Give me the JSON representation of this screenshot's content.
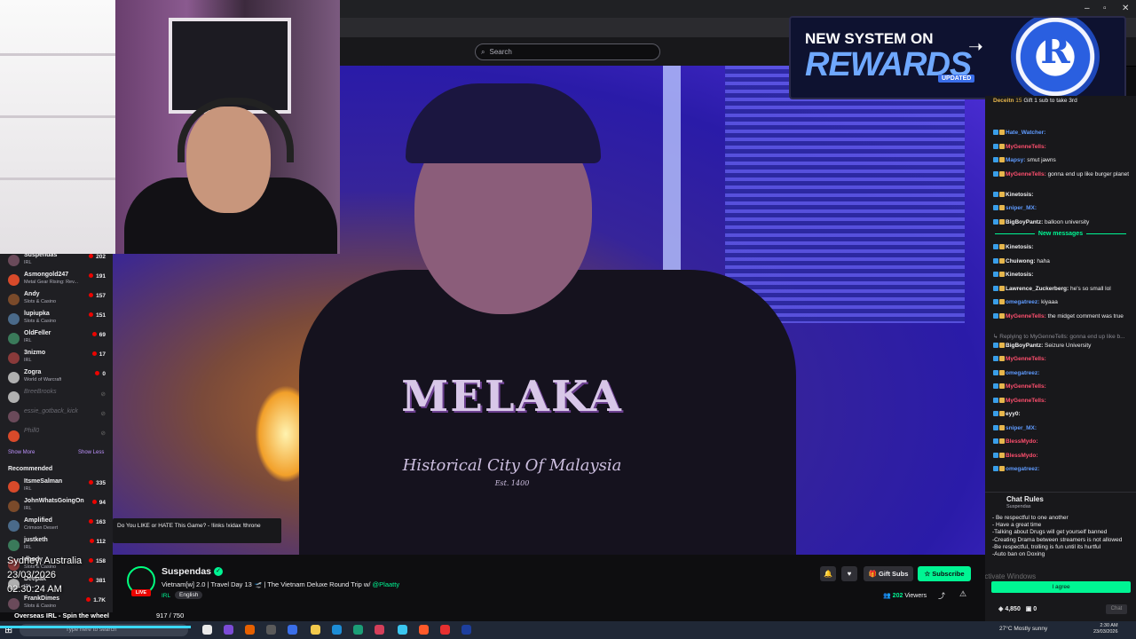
{
  "browser": {
    "search_placeholder": "Search"
  },
  "sidebar": {
    "followed": [
      {
        "name": "Suspendas",
        "game": "IRL",
        "viewers": "202"
      },
      {
        "name": "Asmongold247",
        "game": "Metal Gear Rising: Rev...",
        "viewers": "191"
      },
      {
        "name": "Andy",
        "game": "Slots & Casino",
        "viewers": "157"
      },
      {
        "name": "lupiupka",
        "game": "Slots & Casino",
        "viewers": "151"
      },
      {
        "name": "OldFeller",
        "game": "IRL",
        "viewers": "69"
      },
      {
        "name": "3nizmo",
        "game": "IRL",
        "viewers": "17"
      },
      {
        "name": "Zogra",
        "game": "World of Warcraft",
        "viewers": "0"
      }
    ],
    "offline": [
      "BreeBrooks",
      "essie_gotback_kick",
      "Phill0"
    ],
    "show_more": "Show More",
    "show_less": "Show Less",
    "recommended_heading": "Recommended",
    "recommended": [
      {
        "name": "ItsmeSalman",
        "game": "IRL",
        "viewers": "335"
      },
      {
        "name": "JohnWhatsGoingOn",
        "game": "IRL",
        "viewers": "94"
      },
      {
        "name": "Amplified",
        "game": "Crimson Desert",
        "viewers": "163"
      },
      {
        "name": "justketh",
        "game": "IRL",
        "viewers": "112"
      },
      {
        "name": "dhody",
        "game": "Slots & Casino",
        "viewers": "158"
      },
      {
        "name": "Deepak",
        "game": "IRL",
        "viewers": "381"
      },
      {
        "name": "FrankDimes",
        "game": "Slots & Casino",
        "viewers": "1.7K"
      }
    ]
  },
  "video": {
    "shirt_main": "MELAKA",
    "shirt_sub": "Historical City Of Malaysia",
    "shirt_est": "Est. 1400",
    "popup": "Do You LIKE or HATE This Game? - !links !xidax !throne"
  },
  "banner": {
    "line1": "NEW SYSTEM ON",
    "line2": "REWARDS",
    "updated": "UPDATED",
    "chip_letter": "R"
  },
  "chat": {
    "top_gift_user": "Deceitn",
    "top_gift_count": "15",
    "top_gift_text": "Gift 1 sub to take 3rd",
    "messages": [
      {
        "user": "Hate_Watcher",
        "text": "",
        "color": "#5f9bff"
      },
      {
        "user": "MyGenneTells",
        "text": "",
        "color": "#ff4f6e"
      },
      {
        "user": "Mapsy",
        "text": "smut jawns",
        "color": "#5f9bff"
      },
      {
        "user": "MyGenneTells",
        "text": "gonna end up like burger planet",
        "color": "#ff4f6e"
      },
      {
        "user": "Kinetosis",
        "text": "",
        "color": "#efeff1"
      },
      {
        "user": "sniper_MX",
        "text": "",
        "color": "#5f9bff"
      },
      {
        "user": "BigBoyPantz",
        "text": "balloon university",
        "color": "#efeff1"
      }
    ],
    "new_messages_label": "New messages",
    "messages2": [
      {
        "user": "Kinetosis",
        "text": "",
        "color": "#efeff1"
      },
      {
        "user": "Chuiwong",
        "text": "haha",
        "color": "#efeff1"
      },
      {
        "user": "Kinetosis",
        "text": "",
        "color": "#efeff1"
      },
      {
        "user": "Lawrence_Zuckerberg",
        "text": "he's so small lol",
        "color": "#efeff1"
      },
      {
        "user": "omegatreez",
        "text": "kiyaaa",
        "color": "#5f9bff"
      },
      {
        "user": "MyGenneTells",
        "text": "the midget comment was true",
        "color": "#ff4f6e"
      },
      {
        "user": "BigBoyPantz",
        "text": "Seizure University",
        "color": "#efeff1"
      },
      {
        "user": "MyGenneTells",
        "text": "",
        "color": "#ff4f6e"
      },
      {
        "user": "omegatreez",
        "text": "",
        "color": "#5f9bff"
      },
      {
        "user": "MyGenneTells",
        "text": "",
        "color": "#ff4f6e"
      },
      {
        "user": "MyGenneTells",
        "text": "",
        "color": "#ff4f6e"
      },
      {
        "user": "eyy0",
        "text": "",
        "color": "#efeff1"
      },
      {
        "user": "sniper_MX",
        "text": "",
        "color": "#5f9bff"
      },
      {
        "user": "BlessMydo",
        "text": "",
        "color": "#ff4f6e"
      },
      {
        "user": "BlessMydo",
        "text": "",
        "color": "#ff4f6e"
      },
      {
        "user": "omegatreez",
        "text": "",
        "color": "#5f9bff"
      }
    ],
    "reply_note": "Replying to MyGenneTells: gonna end up like b...",
    "rules_title": "Chat Rules",
    "rules_sub": "Suspendas",
    "rules_body": "- Be respectful to one another\n- Have a great time\n-Talking about Drugs will get yourself banned\n-Creating Drama between streamers is not allowed\n-Be respectful, trolling is fun until its hurtful\n-Auto ban on Doxing",
    "agree": "I agree",
    "points": "4,850",
    "points2": "0",
    "chat_button": "Chat"
  },
  "stream": {
    "streamer": "Suspendas",
    "title": "Vietnam[w] 2.0 | Travel Day 13 🛫 | The Vietnam Deluxe Round Trip w/",
    "title_mention": "@Plaatty",
    "category": "IRL",
    "language": "English",
    "gift_subs": "Gift Subs",
    "subscribe": "Subscribe",
    "viewers": "202",
    "viewers_label": "Viewers",
    "live": "LIVE"
  },
  "overlay": {
    "location": "Sydney, Australia",
    "date": "23/03/2026",
    "time": "02:30:24 AM",
    "spin": "Overseas IRL - Spin the wheel",
    "subs": "917 / 750"
  },
  "taskbar": {
    "search": "Type here to search",
    "weather": "27°C  Mostly sunny",
    "time": "2:30 AM",
    "date": "23/03/2026"
  },
  "watermark": "Activate Windows",
  "colors": {
    "accent": "#00f593",
    "live": "#eb0400",
    "bg": "#0e0e10"
  }
}
